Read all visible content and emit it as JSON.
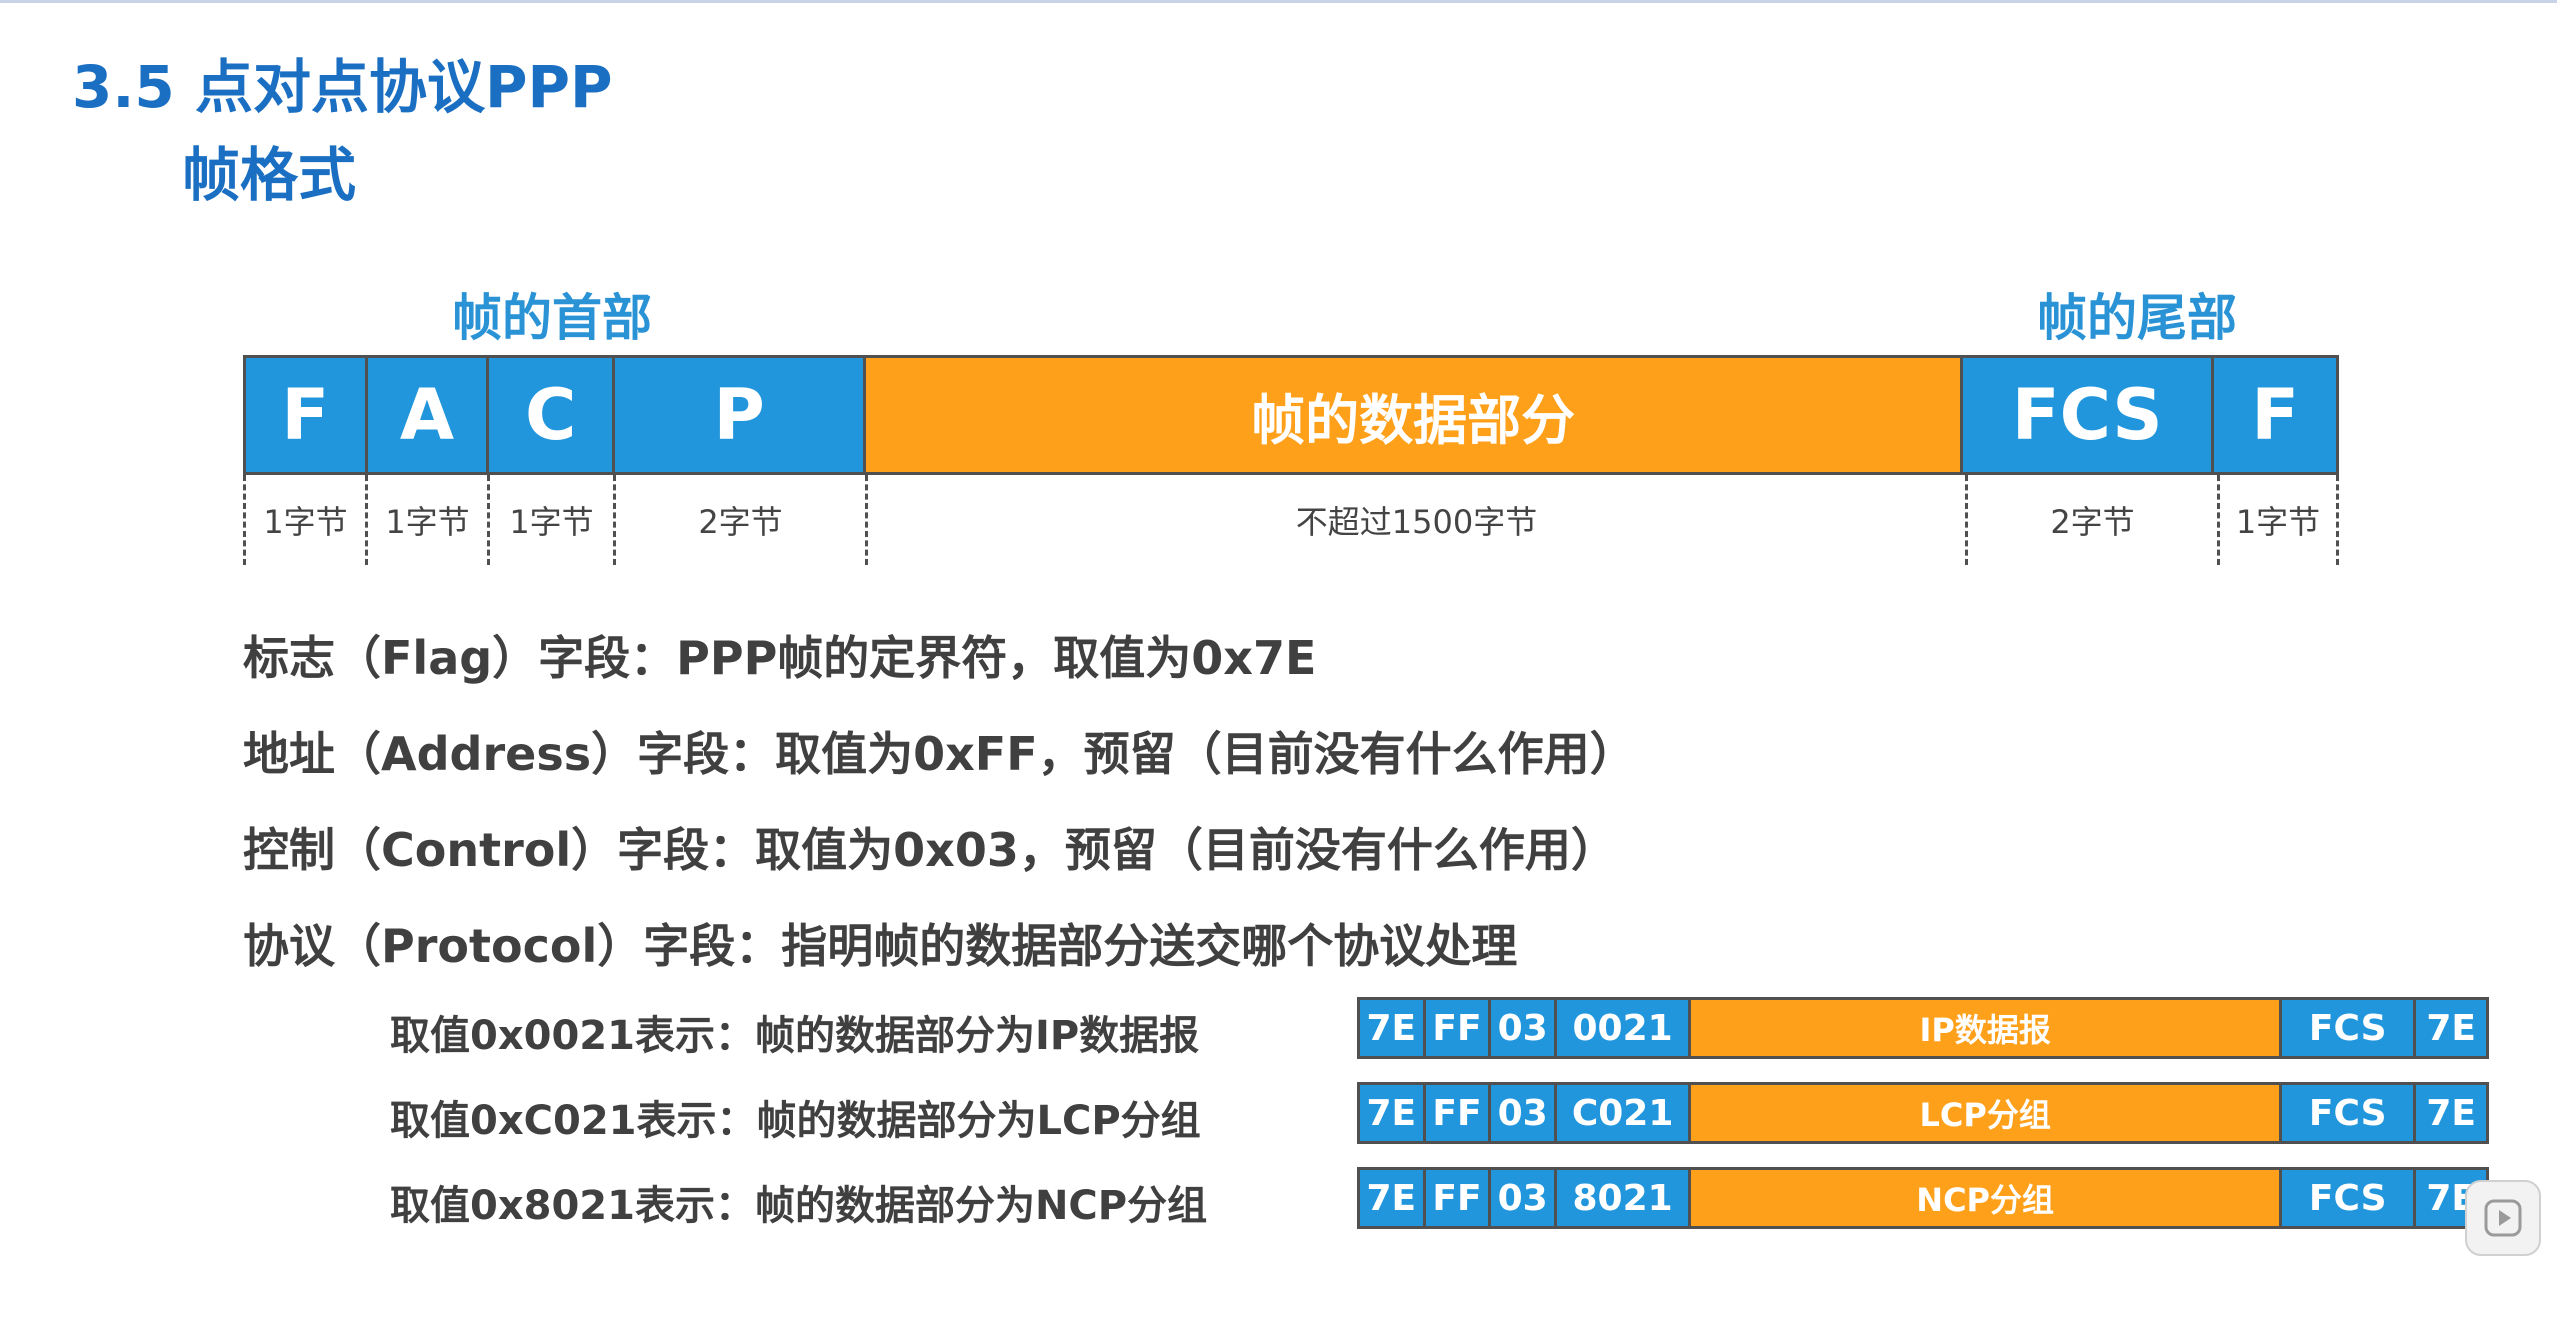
{
  "slide": {
    "title_line1": "3.5 点对点协议PPP",
    "title_line2": "帧格式"
  },
  "frame": {
    "header_label": "帧的首部",
    "trailer_label": "帧的尾部",
    "fields": [
      {
        "label": "F",
        "size": "1字节"
      },
      {
        "label": "A",
        "size": "1字节"
      },
      {
        "label": "C",
        "size": "1字节"
      },
      {
        "label": "P",
        "size": "2字节"
      },
      {
        "label": "帧的数据部分",
        "size": "不超过1500字节"
      },
      {
        "label": "FCS",
        "size": "2字节"
      },
      {
        "label": "F",
        "size": "1字节"
      }
    ]
  },
  "descriptions": [
    "标志（Flag）字段：PPP帧的定界符，取值为0x7E",
    "地址（Address）字段：取值为0xFF，预留（目前没有什么作用）",
    "控制（Control）字段：取值为0x03，预留（目前没有什么作用）",
    "协议（Protocol）字段：指明帧的数据部分送交哪个协议处理"
  ],
  "protocol_examples": [
    {
      "text": "取值0x0021表示：帧的数据部分为IP数据报",
      "cells": [
        "7E",
        "FF",
        "03",
        "0021",
        "IP数据报",
        "FCS",
        "7E"
      ]
    },
    {
      "text": "取值0xC021表示：帧的数据部分为LCP分组",
      "cells": [
        "7E",
        "FF",
        "03",
        "C021",
        "LCP分组",
        "FCS",
        "7E"
      ]
    },
    {
      "text": "取值0x8021表示：帧的数据部分为NCP分组",
      "cells": [
        "7E",
        "FF",
        "03",
        "8021",
        "NCP分组",
        "FCS",
        "7E"
      ]
    }
  ],
  "colors": {
    "title": "#1b6fc2",
    "section_label": "#2a93d5",
    "field_blue": "#2196dc",
    "field_orange": "#ffa01b",
    "body_text": "#404040"
  },
  "icons": {
    "player": "play-icon"
  }
}
